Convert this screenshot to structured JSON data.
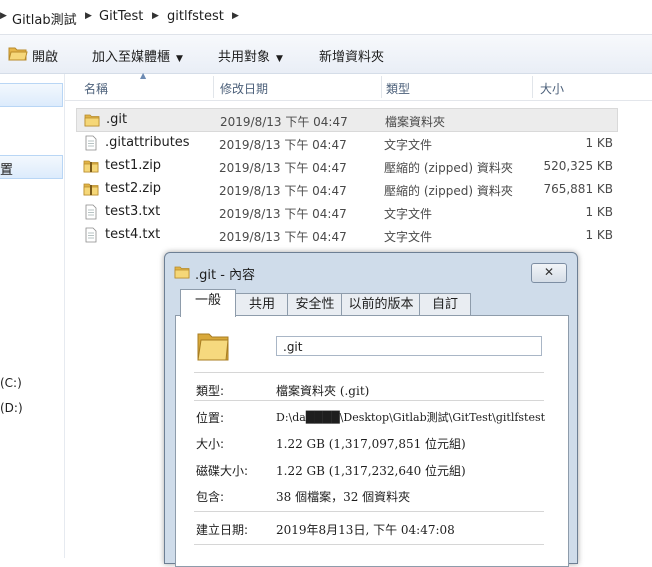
{
  "breadcrumb": {
    "items": [
      "Gitlab測試",
      "GitTest",
      "gitlfstest"
    ]
  },
  "toolbar": {
    "open": "開啟",
    "add_to_library": "加入至媒體櫃",
    "share_with": "共用對象",
    "new_folder": "新增資料夾"
  },
  "nav": {
    "selected_partial": "置",
    "drive_c": "(C:)",
    "drive_d": "(D:)"
  },
  "columns": {
    "name": "名稱",
    "date": "修改日期",
    "type": "類型",
    "size": "大小"
  },
  "files": [
    {
      "name": ".git",
      "date": "2019/8/13 下午 04:47",
      "type": "檔案資料夾",
      "size": "",
      "icon": "folder"
    },
    {
      "name": ".gitattributes",
      "date": "2019/8/13 下午 04:47",
      "type": "文字文件",
      "size": "1 KB",
      "icon": "text-file"
    },
    {
      "name": "test1.zip",
      "date": "2019/8/13 下午 04:47",
      "type": "壓縮的 (zipped) 資料夾",
      "size": "520,325 KB",
      "icon": "zip"
    },
    {
      "name": "test2.zip",
      "date": "2019/8/13 下午 04:47",
      "type": "壓縮的 (zipped) 資料夾",
      "size": "765,881 KB",
      "icon": "zip"
    },
    {
      "name": "test3.txt",
      "date": "2019/8/13 下午 04:47",
      "type": "文字文件",
      "size": "1 KB",
      "icon": "text-file"
    },
    {
      "name": "test4.txt",
      "date": "2019/8/13 下午 04:47",
      "type": "文字文件",
      "size": "1 KB",
      "icon": "text-file"
    }
  ],
  "dialog": {
    "title": ".git - 內容",
    "close": "✕",
    "tabs": [
      "一般",
      "共用",
      "安全性",
      "以前的版本",
      "自訂"
    ],
    "active_tab": 0,
    "name_value": ".git",
    "rows": [
      {
        "label": "類型:",
        "value": "檔案資料夾 (.git)"
      },
      {
        "label": "位置:",
        "value": "D:\\da████\\Desktop\\Gitlab測試\\GitTest\\gitlfstest"
      },
      {
        "label": "大小:",
        "value": "1.22 GB (1,317,097,851 位元組)"
      },
      {
        "label": "磁碟大小:",
        "value": "1.22 GB (1,317,232,640 位元組)"
      },
      {
        "label": "包含:",
        "value": "38 個檔案，32 個資料夾"
      },
      {
        "label": "建立日期:",
        "value": "2019年8月13日, 下午 04:47:08"
      }
    ]
  },
  "colors": {
    "folder": "#e8c25a",
    "selection": "#dcebfc",
    "dialog_frame": "#cfdcea"
  }
}
